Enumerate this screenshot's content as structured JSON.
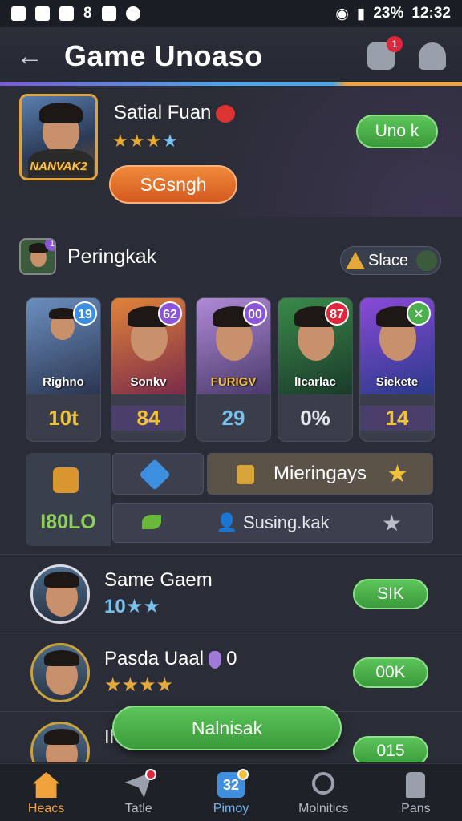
{
  "status_bar": {
    "battery": "23%",
    "time": "12:32",
    "left_glyphs": [
      "8"
    ]
  },
  "header": {
    "title": "Game Unoaso",
    "notif_count": "1"
  },
  "profile": {
    "name": "Satial Fuan",
    "avatar_tag": "NANVAK2",
    "stars_gold": "★★★",
    "stars_blue": "★",
    "action_label": "SGsngh",
    "unlock_label": "Uno k"
  },
  "ranking": {
    "title": "Peringkak",
    "badge": "1",
    "slace_label": "Slace",
    "players": [
      {
        "name": "Righno",
        "value": "10t",
        "badge": "19",
        "badge_color": "#3f8fe0",
        "value_color": "#f2c23a"
      },
      {
        "name": "Sonkv",
        "value": "84",
        "badge": "62",
        "badge_color": "#8a55d8",
        "value_color": "#f2c23a"
      },
      {
        "name": "FURIGV",
        "value": "29",
        "badge": "00",
        "badge_color": "#8a55d8",
        "value_color": "#7ac0ee"
      },
      {
        "name": "lIcarlac",
        "value": "0%",
        "badge": "87",
        "badge_color": "#e0263a",
        "value_color": "#e6e8ee"
      },
      {
        "name": "Siekete",
        "value": "14",
        "badge": "✕",
        "badge_color": "#4cae4c",
        "value_color": "#f2c23a"
      }
    ]
  },
  "stats": {
    "total": "I80LO",
    "mieringays": "Mieringays",
    "susing": "Susing.kak"
  },
  "list": [
    {
      "name": "Same Gaem",
      "sub_num": "10",
      "sub_stars": "★★",
      "button": "SIK"
    },
    {
      "name": "Pasda Uaal",
      "extra": "0",
      "sub_stars": "★★★★",
      "button": "00K"
    },
    {
      "name": "Ih",
      "button": "015"
    }
  ],
  "floating_button": "Nalnisak",
  "nav": [
    {
      "label": "Heacs",
      "active": true
    },
    {
      "label": "Tatle"
    },
    {
      "label": "Pimoy",
      "icon_text": "32"
    },
    {
      "label": "Molnitics"
    },
    {
      "label": "Pans"
    }
  ]
}
